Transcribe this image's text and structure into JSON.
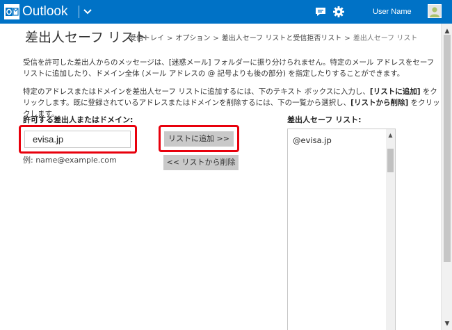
{
  "topbar": {
    "app_name": "Outlook",
    "user_name": "User Name",
    "brand_color": "#0072c6",
    "icons": [
      "outlook-logo-icon",
      "chevron-down-icon",
      "chat-icon",
      "gear-icon",
      "avatar-icon"
    ]
  },
  "header": {
    "title": "差出人セーフ リスト",
    "breadcrumb": [
      "受信トレイ",
      "オプション",
      "差出人セーフ リストと受信拒否リスト",
      "差出人セーフ リスト"
    ],
    "breadcrumb_separator": ">"
  },
  "description": {
    "p1": "受信を許可した差出人からのメッセージは、[迷惑メール] フォルダーに振り分けられません。特定のメール アドレスをセーフ リストに追加したり、ドメイン全体 (メール アドレスの @ 記号よりも後の部分) を指定したりすることができます。",
    "p2_a": "特定のアドレスまたはドメインを差出人セーフ リストに追加するには、下のテキスト ボックスに入力し、",
    "p2_b": "[リストに追加]",
    "p2_c": " をクリックします。既に登録されているアドレスまたはドメインを削除するには、下の一覧から選択し、",
    "p2_d": "[リストから削除]",
    "p2_e": " をクリックします。"
  },
  "form": {
    "allowed_label": "許可する差出人またはドメイン:",
    "input_value": "evisa.jp",
    "example": "例: name@example.com",
    "add_button": "リストに追加 >>",
    "remove_button": "<< リストから削除",
    "safe_list_label": "差出人セーフ リスト:",
    "safe_list_items": [
      "@evisa.jp"
    ],
    "highlight_color": "#e8000c"
  }
}
